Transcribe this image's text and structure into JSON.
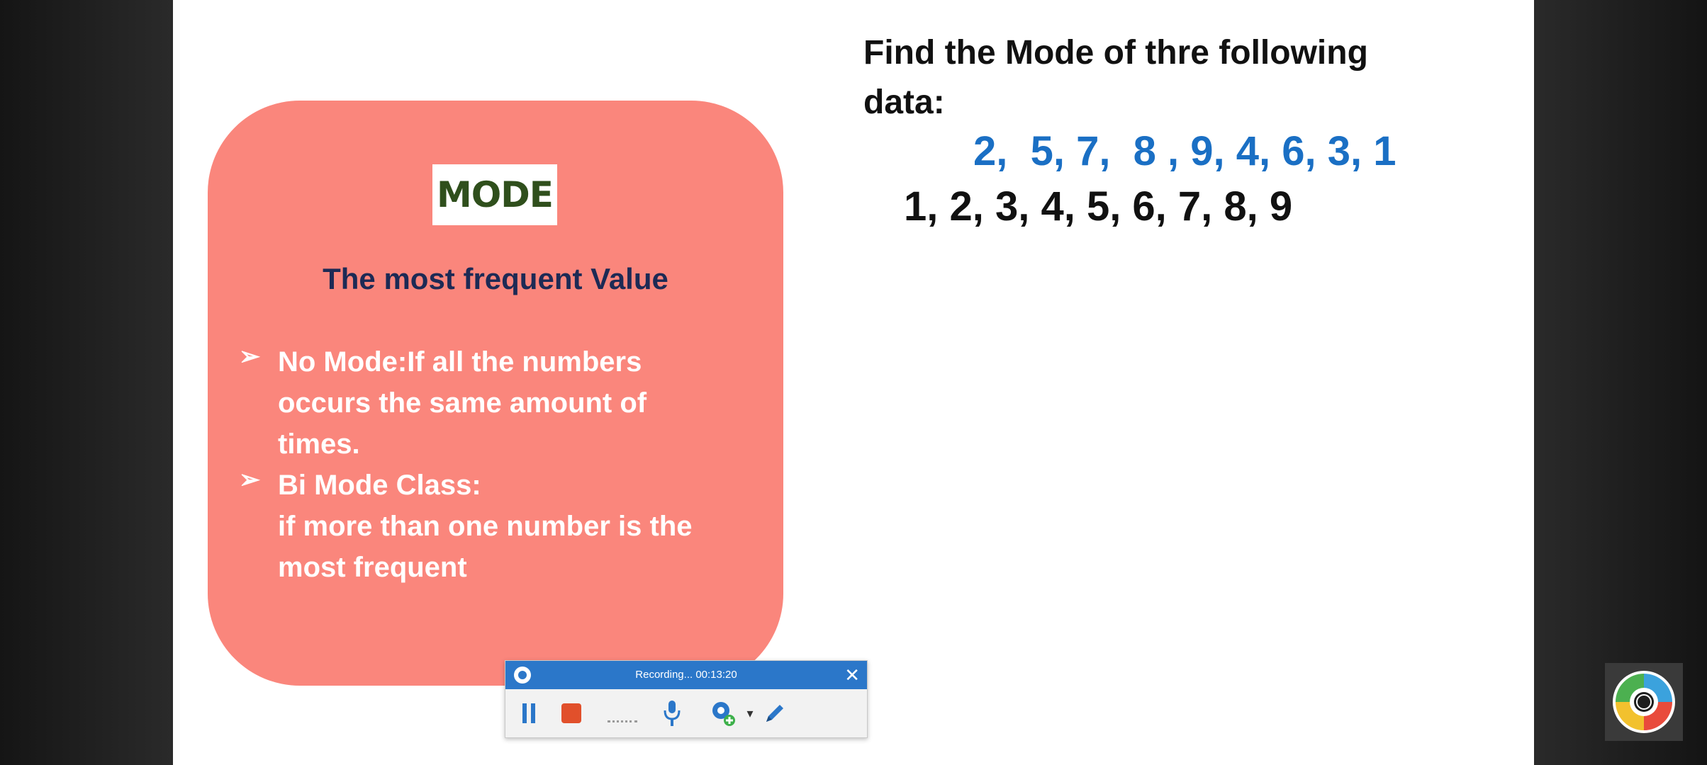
{
  "slide": {
    "card": {
      "heading": "MODE",
      "subtitle": "The most frequent Value",
      "bullets": [
        {
          "marker": "➢",
          "lines": [
            "No Mode:If all the numbers",
            "occurs the same amount of",
            "times."
          ]
        },
        {
          "marker": "➢",
          "lines": [
            "Bi Mode Class:",
            "if more than one number is the",
            "most frequent"
          ]
        }
      ]
    },
    "question": {
      "line1": "Find the Mode of thre following",
      "line2": "data:"
    },
    "data_original": "2,  5, 7,  8 , 9, 4, 6, 3, 1",
    "data_sorted": "1, 2, 3, 4, 5, 6, 7, 8, 9"
  },
  "recorder": {
    "status": "Recording... 00:13:20",
    "close_symbol": "✕",
    "camera_caret": "▾",
    "accent_color": "#2b77c9",
    "stop_color": "#e1502b"
  },
  "colors": {
    "card": "#fa867c",
    "data_blue": "#1a6fc4",
    "heading_green": "#2f4f1c",
    "subtitle_navy": "#1d2a55"
  }
}
